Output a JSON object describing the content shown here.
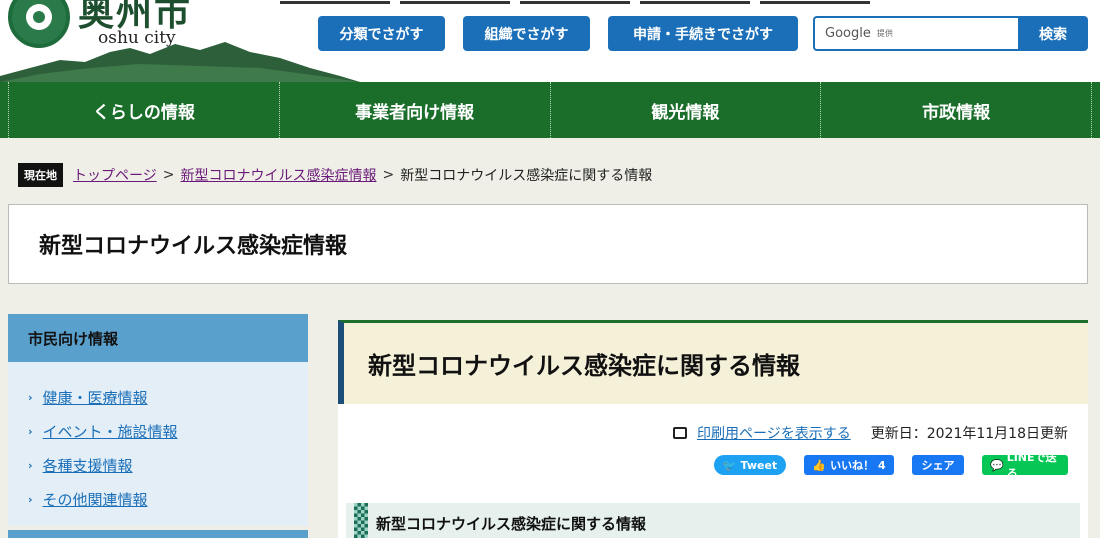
{
  "header": {
    "logo_kanji": "奥州市",
    "logo_roman": "oshu city",
    "nav_buttons": [
      "分類でさがす",
      "組織でさがす",
      "申請・手続きでさがす"
    ],
    "search_placeholder": "Google",
    "search_provided": "提供",
    "search_button": "検索"
  },
  "global_nav": [
    "くらしの情報",
    "事業者向け情報",
    "観光情報",
    "市政情報"
  ],
  "breadcrumb": {
    "label": "現在地",
    "items": [
      "トップページ",
      "新型コロナウイルス感染症情報"
    ],
    "current": "新型コロナウイルス感染症に関する情報",
    "separator": ">"
  },
  "page_title": "新型コロナウイルス感染症情報",
  "sidebar": {
    "heading": "市民向け情報",
    "items": [
      "健康・医療情報",
      "イベント・施設情報",
      "各種支援情報",
      "その他関連情報"
    ]
  },
  "main": {
    "heading": "新型コロナウイルス感染症に関する情報",
    "print_link": "印刷用ページを表示する",
    "updated": "更新日：2021年11月18日更新",
    "social": {
      "tweet": "Tweet",
      "like": "いいね！ 4",
      "share": "シェア",
      "line": "LINEで送る"
    },
    "subheading": "新型コロナウイルス感染症に関する情報"
  },
  "colors": {
    "green_nav": "#1a6e2a",
    "blue_button": "#1b6fb8",
    "sidebar_head": "#5aa0cc"
  }
}
